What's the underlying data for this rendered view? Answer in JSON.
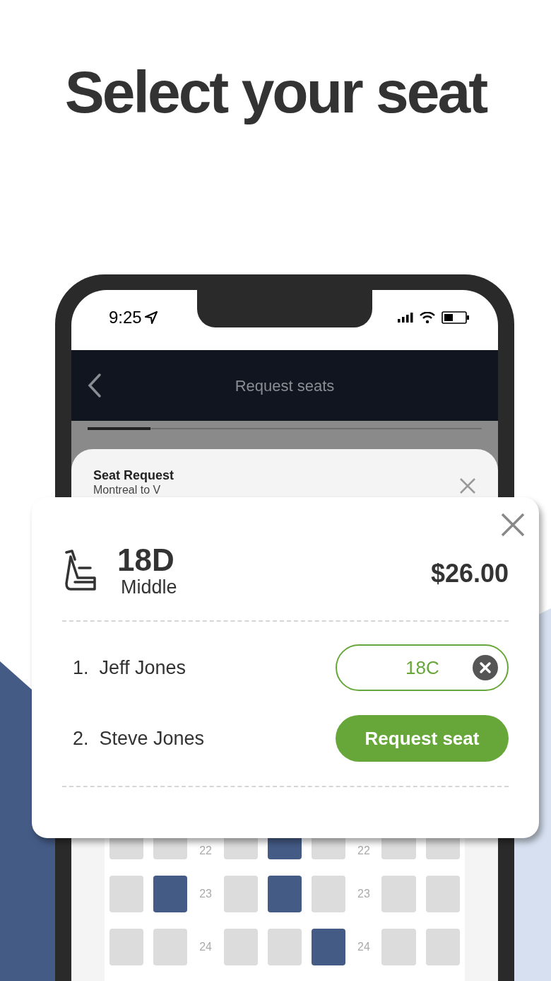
{
  "headline": "Select your seat",
  "status_bar": {
    "time": "9:25"
  },
  "nav": {
    "title": "Request seats"
  },
  "progress": {
    "level": 0.16
  },
  "card": {
    "title": "Seat Request",
    "subtitle": "Montreal to V"
  },
  "seat_rows": [
    {
      "numbers": [
        "22",
        "22"
      ],
      "seats": [
        false,
        false,
        false,
        true,
        false,
        false,
        false
      ]
    },
    {
      "numbers": [
        "23",
        "23"
      ],
      "seats": [
        false,
        true,
        false,
        true,
        false,
        false,
        false
      ]
    },
    {
      "numbers": [
        "24",
        "24"
      ],
      "seats": [
        false,
        false,
        false,
        false,
        true,
        false,
        false
      ]
    }
  ],
  "popup": {
    "seat": "18D",
    "seat_type": "Middle",
    "price": "$26.00",
    "passengers": [
      {
        "label": "1.  Jeff Jones",
        "kind": "assigned",
        "seat": "18C"
      },
      {
        "label": "2.  Steve Jones",
        "kind": "request",
        "action": "Request seat"
      }
    ]
  }
}
